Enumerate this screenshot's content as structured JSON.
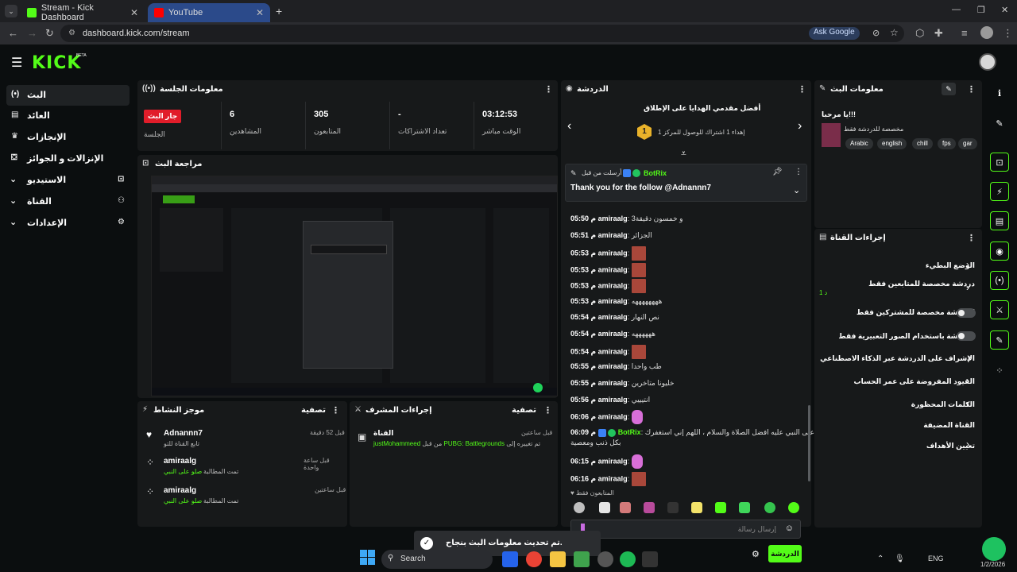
{
  "browser": {
    "tabs": [
      {
        "title": "Stream - Kick Dashboard",
        "active": true
      },
      {
        "title": "YouTube",
        "active": false
      }
    ],
    "url": "dashboard.kick.com/stream",
    "ask_google": "Ask Google"
  },
  "brand": {
    "logo": "KICK",
    "beta": "BETA",
    "accent": "#53fc18"
  },
  "sidebar": {
    "items": [
      {
        "label": "البث",
        "icon": "broadcast-icon"
      },
      {
        "label": "العائد",
        "icon": "wallet-icon"
      },
      {
        "label": "الإنجازات",
        "icon": "trophy-icon"
      },
      {
        "label": "الإنزالات و الجوائز",
        "icon": "gift-icon"
      },
      {
        "label": "الاستيديو",
        "icon": "studio-icon"
      },
      {
        "label": "القناة",
        "icon": "channel-icon"
      },
      {
        "label": "الإعدادات",
        "icon": "gear-icon"
      }
    ]
  },
  "session": {
    "title": "معلومات الجلسة",
    "live_badge": "جار البث",
    "session_label": "الجلسة",
    "stats": [
      {
        "value": "6",
        "label": "المشاهدين"
      },
      {
        "value": "305",
        "label": "المتابعون"
      },
      {
        "value": "-",
        "label": "تعداد الاشتراكات"
      },
      {
        "value": "03:12:53",
        "label": "الوقت مباشر"
      }
    ]
  },
  "preview": {
    "title": "مراجعة البث"
  },
  "activity": {
    "title": "موجز النشاط",
    "filter": "تصفية",
    "items": [
      {
        "user": "Adnannn7",
        "desc": "تابع القناة للتو",
        "time": "قبل 52 دقيقة",
        "icon": "heart-icon"
      },
      {
        "user": "amiraalg",
        "desc_prefix": "تمت المطالبة",
        "desc_highlight": "صلو على النبي",
        "time": "قبل ساعة واحدة",
        "icon": "reward-icon"
      },
      {
        "user": "amiraalg",
        "desc_prefix": "تمت المطالبة",
        "desc_highlight": "صلو على النبي",
        "time": "قبل ساعتين",
        "icon": "reward-icon"
      }
    ]
  },
  "mod_actions": {
    "title": "إجراءات المشرف",
    "filter": "تصفية",
    "item": {
      "heading": "القناة",
      "time": "قبل ساعتين",
      "text_a": "تم تغييره إلى",
      "game": "PUBG: Battlegrounds",
      "text_b": "من قبل",
      "by": "justMohammeed"
    }
  },
  "chat": {
    "title": "الدردشة",
    "pinned_title": "أفضل مقدمي الهدايا على الإطلاق",
    "pinned_sub": "إهداء 1 اشتراك للوصول للمركز 1",
    "pinned_rank": "1",
    "pinned_msg_header": "أرسلت من قبل",
    "pinned_msg_user": "BotRix",
    "pinned_msg_text": "Thank you for the follow @Adnannn7",
    "messages": [
      {
        "time": "05:50 م",
        "user": "amiraalg",
        "text": "و خمسون دقيقة3"
      },
      {
        "time": "05:51 م",
        "user": "amiraalg",
        "text": "الجزائر"
      },
      {
        "time": "05:53 م",
        "user": "amiraalg",
        "emote": "red"
      },
      {
        "time": "05:53 م",
        "user": "amiraalg",
        "emote": "red"
      },
      {
        "time": "05:53 م",
        "user": "amiraalg",
        "emote": "red"
      },
      {
        "time": "05:53 م",
        "user": "amiraalg",
        "text": "ههههههههه"
      },
      {
        "time": "05:54 م",
        "user": "amiraalg",
        "text": "نص النهار"
      },
      {
        "time": "05:54 م",
        "user": "amiraalg",
        "text": "ههههههه"
      },
      {
        "time": "05:54 م",
        "user": "amiraalg",
        "emote": "red"
      },
      {
        "time": "05:55 م",
        "user": "amiraalg",
        "text": "طب واحدا"
      },
      {
        "time": "05:55 م",
        "user": "amiraalg",
        "text": "خليونا متاخرين"
      },
      {
        "time": "05:56 م",
        "user": "amiraalg",
        "text": "انتيييي"
      },
      {
        "time": "06:06 م",
        "user": "amiraalg",
        "emote": "purple"
      },
      {
        "time": "06:09 م",
        "user": "BotRix",
        "text": "صلو على النبي عليه افضل الصلاة والسلام ، اللهم إني استغفرك",
        "text2": "بكل ذنب ومعصية"
      },
      {
        "time": "06:15 م",
        "user": "amiraalg",
        "emote": "purple"
      },
      {
        "time": "06:16 م",
        "user": "amiraalg",
        "emote": "red"
      }
    ],
    "followers_only": "المتابعون فقط",
    "input_placeholder": "إرسال رسالة",
    "send_label": "الدردشة"
  },
  "stream_info": {
    "title": "معلومات البث",
    "greeting": "يا مرحبا!!!",
    "category": "مخصصة للدردشة فقط",
    "tags": [
      "Arabic",
      "english",
      "chill",
      "fps",
      "gar"
    ]
  },
  "channel_actions": {
    "title": "إجراءات القناة",
    "rows": [
      {
        "label": "الوضع البطيء",
        "control": "chevron"
      },
      {
        "label": "دردشة مخصصة للمتابعين فقط",
        "sub": "1 د",
        "control": "chevron"
      },
      {
        "label": "الدردشة مخصصة للمشتركين فقط",
        "control": "toggle"
      },
      {
        "label": "الدردشة باستخدام الصور التعبيرية فقط",
        "control": "toggle"
      },
      {
        "label": "الإشراف على الدردشة عبر الذكاء الاصطناعي",
        "control": "external"
      },
      {
        "label": "القيود المفروضة على عمر الحساب",
        "control": "chevron"
      },
      {
        "label": "الكلمات المحظورة",
        "control": "chevron"
      },
      {
        "label": "القناة المضيفة",
        "control": "none"
      },
      {
        "label": "تعيين الأهداف",
        "control": "chevron"
      }
    ]
  },
  "toast": {
    "text": "تم تحديث معلومات البث بنجاح."
  },
  "taskbar": {
    "search": "Search",
    "lang": "ENG",
    "date": "1/2/2026"
  }
}
